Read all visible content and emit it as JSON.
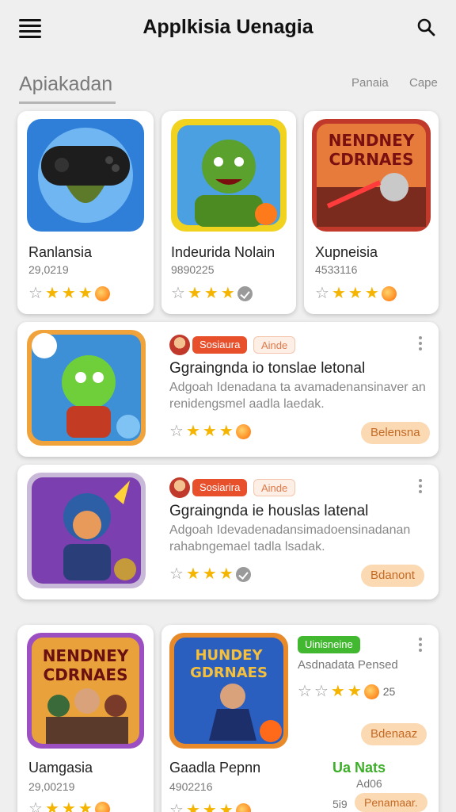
{
  "header": {
    "title": "Applkisia Uenagia"
  },
  "tabs": {
    "active": "Apiakadan",
    "right": [
      "Panaia",
      "Cape"
    ]
  },
  "top_cards": [
    {
      "name": "Ranlansia",
      "count": "29,0219",
      "stars": 3,
      "badge": "fire"
    },
    {
      "name": "Indeurida Nolain",
      "count": "9890225",
      "stars": 3,
      "badge": "check"
    },
    {
      "name": "Xupneisia",
      "count": "4533116",
      "stars": 3,
      "badge": "fire",
      "thumb_text": [
        "NENDNEY",
        "CDRNAES"
      ]
    }
  ],
  "feature_cards": [
    {
      "chip1": "Sosiaura",
      "chip2": "Ainde",
      "headline": "Ggraingnda io tonslae letonal",
      "desc": [
        "Adgoah Idenadana ta avamadenansinaver an",
        "renidengsmel aadla laedak."
      ],
      "stars": 3,
      "badge": "fire",
      "button": "Belensna"
    },
    {
      "chip1": "Sosiarira",
      "chip2": "Ainde",
      "headline": "Ggraingnda ie houslas latenal",
      "desc": [
        "Adgoah Idevadenadansimadoensinadanan",
        "rahabngemael tadla lsadak."
      ],
      "stars": 3,
      "badge": "check",
      "button": "Bdanont"
    }
  ],
  "bottom_left": {
    "name": "Uamgasia",
    "count": "29,00219",
    "thumb_text": [
      "NENDNEY",
      "CDRNAES"
    ]
  },
  "bottom_right": {
    "name": "Gaadla Pepnn",
    "count": "4902216",
    "thumb_text": [
      "HUNDEY",
      "GDRNAES"
    ],
    "chip": "Uinisneine",
    "subtitle": "Asdnadata Pensed",
    "rating_num": "25",
    "button": "Bdenaaz",
    "green_label": "Ua Nats",
    "small_label": "Ad06",
    "small_num": "5i9",
    "button2": "Penamaar."
  }
}
